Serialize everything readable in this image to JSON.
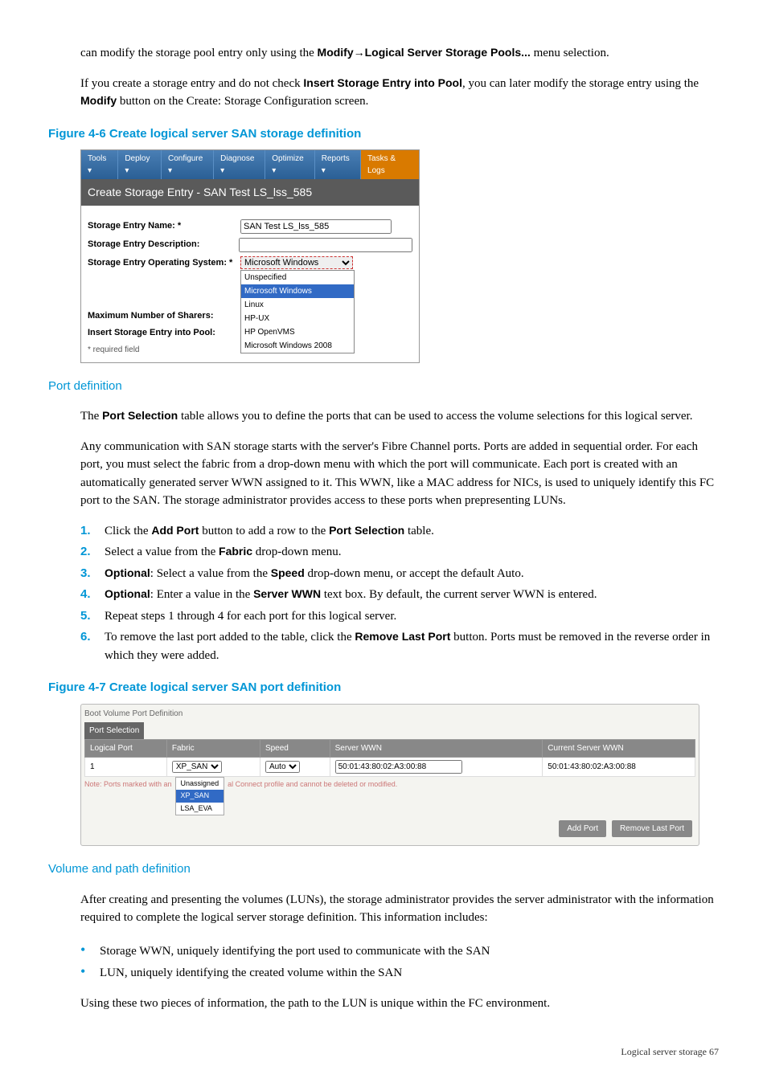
{
  "intro": {
    "p1a": "can modify the storage pool entry only using the ",
    "p1b": "Modify→Logical Server Storage Pools...",
    "p1c": " menu selection.",
    "p2a": "If you create a storage entry and do not check ",
    "p2b": "Insert Storage Entry into Pool",
    "p2c": ", you can later modify the storage entry using the ",
    "p2d": "Modify",
    "p2e": " button on the Create: Storage Configuration screen."
  },
  "fig46": {
    "caption": "Figure 4-6 Create logical server SAN storage definition",
    "toolbar": [
      "Tools ▾",
      "Deploy ▾",
      "Configure ▾",
      "Diagnose ▾",
      "Optimize ▾",
      "Reports ▾",
      "Tasks & Logs"
    ],
    "title": "Create Storage Entry - SAN Test LS_lss_585",
    "name_label": "Storage Entry Name: *",
    "name_value": "SAN Test LS_lss_585",
    "desc_label": "Storage Entry Description:",
    "os_label": "Storage Entry Operating System: *",
    "os_value": "Microsoft Windows",
    "sharers_label": "Maximum Number of Sharers:",
    "insert_label": "Insert Storage Entry into Pool:",
    "required": "* required field",
    "options": [
      "Unspecified",
      "Microsoft Windows",
      "Linux",
      "HP-UX",
      "HP OpenVMS",
      "Microsoft Windows 2008"
    ]
  },
  "portdef": {
    "heading": "Port definition",
    "p1a": "The ",
    "p1b": "Port Selection",
    "p1c": " table allows you to define the ports that can be used to access the volume selections for this logical server.",
    "p2": "Any communication with SAN storage starts with the server's Fibre Channel ports. Ports are added in sequential order. For each port, you must select the fabric from a drop-down menu with which the port will communicate. Each port is created with an automatically generated server WWN assigned to it. This WWN, like a MAC address for NICs, is used to uniquely identify this FC port to the SAN. The storage administrator provides access to these ports when prepresenting LUNs.",
    "steps": [
      {
        "n": "1.",
        "a": "Click the ",
        "b": "Add Port",
        "c": " button to add a row to the ",
        "d": "Port Selection",
        "e": " table."
      },
      {
        "n": "2.",
        "a": "Select a value from the ",
        "b": "Fabric",
        "c": " drop-down menu.",
        "d": "",
        "e": ""
      },
      {
        "n": "3.",
        "a": "",
        "b": "Optional",
        "c": ": Select a value from the ",
        "d": "Speed",
        "e": " drop-down menu, or accept the default Auto."
      },
      {
        "n": "4.",
        "a": "",
        "b": "Optional",
        "c": ": Enter a value in the ",
        "d": "Server WWN",
        "e": " text box. By default, the current server WWN is entered."
      },
      {
        "n": "5.",
        "a": "Repeat steps 1 through 4 for each port for this logical server.",
        "b": "",
        "c": "",
        "d": "",
        "e": ""
      },
      {
        "n": "6.",
        "a": "To remove the last port added to the table, click the ",
        "b": "Remove Last Port",
        "c": " button. Ports must be removed in the reverse order in which they were added.",
        "d": "",
        "e": ""
      }
    ]
  },
  "fig47": {
    "caption": "Figure 4-7 Create logical server SAN port definition",
    "legend": "Boot Volume Port Definition",
    "tab": "Port Selection",
    "headers": [
      "Logical Port",
      "Fabric",
      "Speed",
      "Server WWN",
      "Current Server WWN"
    ],
    "row": {
      "port": "1",
      "fabric": "XP_SAN",
      "speed": "Auto",
      "wwn": "50:01:43:80:02:A3:00:88",
      "cwwn": "50:01:43:80:02:A3:00:88"
    },
    "note_a": "Note: Ports marked with an ",
    "note_b": "al Connect profile and cannot be deleted or modified.",
    "fabric_opts": [
      "Unassigned",
      "XP_SAN",
      "LSA_EVA"
    ],
    "btn_add": "Add Port",
    "btn_remove": "Remove Last Port"
  },
  "voldef": {
    "heading": "Volume and path definition",
    "p1": "After creating and presenting the volumes (LUNs), the storage administrator provides the server administrator with the information required to complete the logical server storage definition. This information includes:",
    "bullets": [
      "Storage WWN, uniquely identifying the port used to communicate with the SAN",
      "LUN, uniquely identifying the created volume within the SAN"
    ],
    "p2": "Using these two pieces of information, the path to the LUN is unique within the FC environment."
  },
  "footer": "Logical server storage   67"
}
